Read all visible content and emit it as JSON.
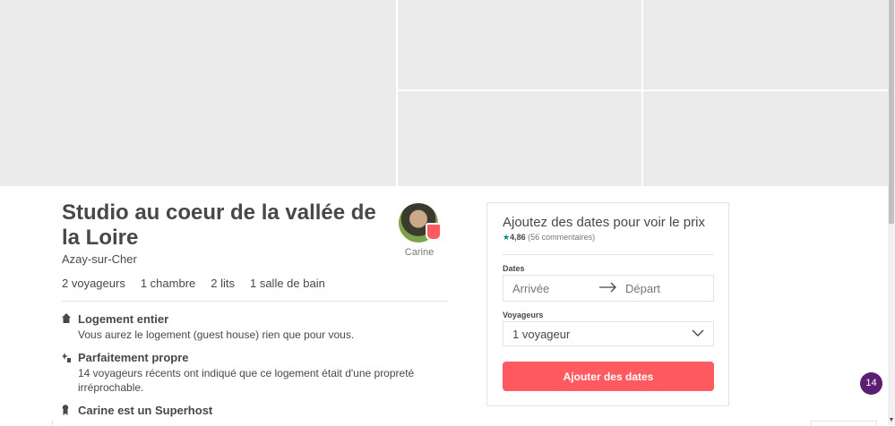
{
  "listing": {
    "title": "Studio au coeur de la vallée de la Loire",
    "location": "Azay-sur-Cher",
    "stats": {
      "guests": "2 voyageurs",
      "bedrooms": "1 chambre",
      "beds": "2 lits",
      "bathrooms": "1 salle de bain"
    }
  },
  "host": {
    "name": "Carine",
    "avatar_icon": "host-avatar",
    "badge_icon": "superhost-badge-icon"
  },
  "features": [
    {
      "icon": "home-icon",
      "title": "Logement entier",
      "description": "Vous aurez le logement (guest house) rien que pour vous."
    },
    {
      "icon": "sparkle-clean-icon",
      "title": "Parfaitement propre",
      "description": "14 voyageurs récents ont indiqué que ce logement était d'une propreté irréprochable."
    },
    {
      "icon": "superhost-medal-icon",
      "title": "Carine est un Superhost",
      "description": ""
    }
  ],
  "booking": {
    "title": "Ajoutez des dates pour voir le prix",
    "rating_score": "4,86",
    "rating_count": "(56 commentaires)",
    "dates_label": "Dates",
    "checkin_placeholder": "Arrivée",
    "checkout_placeholder": "Départ",
    "guests_label": "Voyageurs",
    "guests_value": "1 voyageur",
    "cta_label": "Ajouter des dates"
  },
  "notification": {
    "count": "14"
  },
  "colors": {
    "brand": "#ff5a5f",
    "text": "#484848",
    "muted": "#767676",
    "rating_star": "#008489",
    "photo_placeholder": "#ebebeb",
    "notification_bg": "#5a1e72"
  }
}
